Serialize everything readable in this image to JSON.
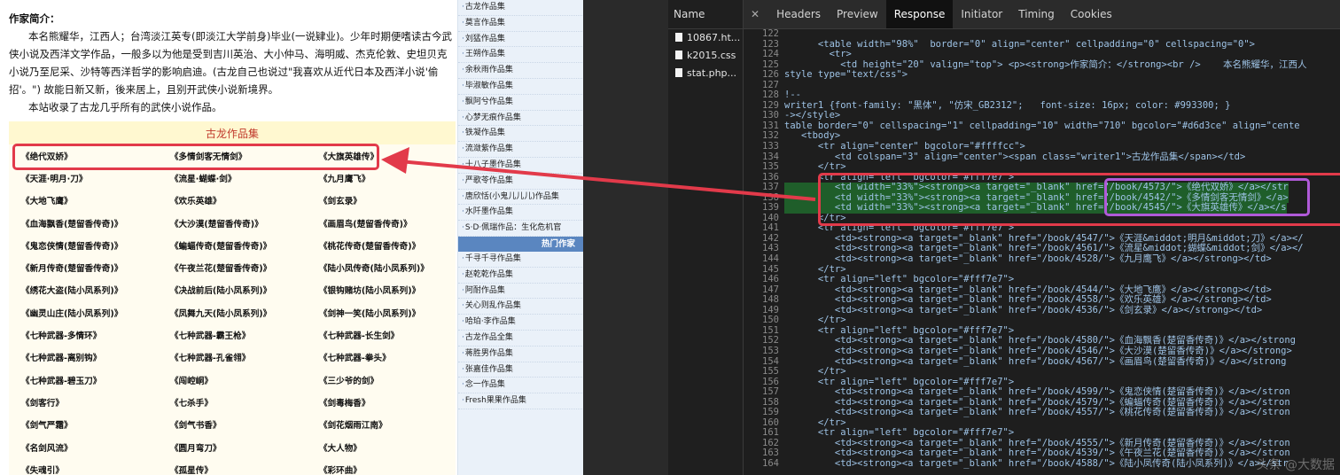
{
  "intro": {
    "heading": "作家简介：",
    "paragraph1": "本名熊耀华，江西人；台湾淡江英专(即淡江大学前身)毕业(一说肄业)。少年时期便嗜读古今武侠小说及西洋文学作品，一般多以为他是受到吉川英治、大小仲马、海明威、杰克伦敦、史坦贝克小说乃至尼采、沙特等西洋哲学的影响启迪。(古龙自己也说过\"我喜欢从近代日本及西洋小说'偷招'。\") 故能日新又新，後来居上，且别开武侠小说新境界。",
    "paragraph2": "本站收录了古龙几乎所有的武侠小说作品。"
  },
  "book_table": {
    "title": "古龙作品集",
    "rows": [
      [
        "《绝代双娇》",
        "《多情剑客无情剑》",
        "《大旗英雄传》"
      ],
      [
        "《天涯·明月·刀》",
        "《流星·蝴蝶·剑》",
        "《九月鹰飞》"
      ],
      [
        "《大地飞鹰》",
        "《欢乐英雄》",
        "《剑玄录》"
      ],
      [
        "《血海飘香(楚留香传奇)》",
        "《大沙漠(楚留香传奇)》",
        "《画眉鸟(楚留香传奇)》"
      ],
      [
        "《鬼恋侠情(楚留香传奇)》",
        "《蝙蝠传奇(楚留香传奇)》",
        "《桃花传奇(楚留香传奇)》"
      ],
      [
        "《新月传奇(楚留香传奇)》",
        "《午夜兰花(楚留香传奇)》",
        "《陆小凤传奇(陆小凤系列)》"
      ],
      [
        "《绣花大盗(陆小凤系列)》",
        "《决战前后(陆小凤系列)》",
        "《银钩赌坊(陆小凤系列)》"
      ],
      [
        "《幽灵山庄(陆小凤系列)》",
        "《凤舞九天(陆小凤系列)》",
        "《剑神一笑(陆小凤系列)》"
      ],
      [
        "《七种武器-多情环》",
        "《七种武器-霸王枪》",
        "《七种武器-长生剑》"
      ],
      [
        "《七种武器-离别钩》",
        "《七种武器-孔雀翎》",
        "《七种武器-拳头》"
      ],
      [
        "《七种武器-碧玉刀》",
        "《闯崆峒》",
        "《三少爷的剑》"
      ],
      [
        "《剑客行》",
        "《七杀手》",
        "《剑毒梅香》"
      ],
      [
        "《剑气严霜》",
        "《剑气书香》",
        "《剑花烟雨江南》"
      ],
      [
        "《名剑风流》",
        "《圆月弯刀》",
        "《大人物》"
      ],
      [
        "《失魂引》",
        "《孤星传》",
        "《彩环曲》"
      ]
    ]
  },
  "sidebar": {
    "items_top": [
      "古龙作品集",
      "莫言作品集",
      "刘猛作品集",
      "王朔作品集",
      "余秋雨作品集",
      "毕淑敏作品集",
      "飘阿兮作品集",
      "心梦无痕作品集",
      "铁凝作品集",
      "流潋紫作品集",
      "十八子墨作品集",
      "严歌苓作品集",
      "唐欣恬(小鬼儿儿儿)作品集",
      "水阡墨作品集",
      "S·D·佩瑞作品：生化危机官"
    ],
    "section_header": "热门作家",
    "items_bottom": [
      "千寻千寻作品集",
      "赵乾乾作品集",
      "阿耐作品集",
      "关心则乱作品集",
      "哈珀·李作品集",
      "古龙作品全集",
      "蒋胜男作品集",
      "张嘉佳作品集",
      "念一作品集",
      "Fresh果果作品集"
    ]
  },
  "devtools": {
    "name_header": "Name",
    "files": [
      "10867.ht...",
      "k2015.css",
      "stat.php..."
    ],
    "tabs": [
      "Headers",
      "Preview",
      "Response",
      "Initiator",
      "Timing",
      "Cookies"
    ],
    "active_tab": "Response",
    "code_lines": [
      {
        "n": "122",
        "t": ""
      },
      {
        "n": "123",
        "t": "      <table width=\"98%\"  border=\"0\" align=\"center\" cellpadding=\"0\" cellspacing=\"0\">"
      },
      {
        "n": "124",
        "t": "        <tr>"
      },
      {
        "n": "125",
        "t": "          <td height=\"20\" valign=\"top\"> <p><strong>作家简介：</strong><br />    本名熊耀华，江西人"
      },
      {
        "n": "126",
        "t": "style type=\"text/css\">"
      },
      {
        "n": "127",
        "t": ""
      },
      {
        "n": "128",
        "t": "!--"
      },
      {
        "n": "129",
        "t": "writer1 {font-family: \"黑体\", \"仿宋_GB2312\";   font-size: 16px; color: #993300; }"
      },
      {
        "n": "130",
        "t": "-></style>"
      },
      {
        "n": "131",
        "t": "table border=\"0\" cellspacing=\"1\" cellpadding=\"10\" width=\"710\" bgcolor=\"#d6d3ce\" align=\"cente"
      },
      {
        "n": "132",
        "t": "   <tbody>"
      },
      {
        "n": "133",
        "t": "      <tr align=\"center\" bgcolor=\"#ffffcc\">"
      },
      {
        "n": "134",
        "t": "         <td colspan=\"3\" align=\"center\"><span class=\"writer1\">古龙作品集</span></td>"
      },
      {
        "n": "135",
        "t": "      </tr>"
      },
      {
        "n": "136",
        "t": "      <tr align=\"left\" bgcolor=\"#fff7e7\">"
      },
      {
        "n": "137",
        "t": "         <td width=\"33%\"><strong><a target=\"_blank\" href=\"/book/4573/\">《绝代双娇》</a></str"
      },
      {
        "n": "138",
        "t": "         <td width=\"33%\"><strong><a target=\"_blank\" href=\"/book/4542/\">《多情剑客无情剑》</a>"
      },
      {
        "n": "139",
        "t": "         <td width=\"33%\"><strong><a target=\"_blank\" href=\"/book/4545/\">《大旗英雄传》</a></s"
      },
      {
        "n": "140",
        "t": "      </tr>"
      },
      {
        "n": "141",
        "t": "      <tr align=\"left\" bgcolor=\"#fff7e7\">"
      },
      {
        "n": "142",
        "t": "         <td><strong><a target=\"_blank\" href=\"/book/4547/\">《天涯&middot;明月&middot;刀》</a></"
      },
      {
        "n": "143",
        "t": "         <td><strong><a target=\"_blank\" href=\"/book/4561/\">《流星&middot;蝴蝶&middot;剑》</a></"
      },
      {
        "n": "144",
        "t": "         <td><strong><a target=\"_blank\" href=\"/book/4528/\">《九月鹰飞》</a></strong></td>"
      },
      {
        "n": "145",
        "t": "      </tr>"
      },
      {
        "n": "146",
        "t": "      <tr align=\"left\" bgcolor=\"#fff7e7\">"
      },
      {
        "n": "147",
        "t": "         <td><strong><a target=\"_blank\" href=\"/book/4544/\">《大地飞鹰》</a></strong></td>"
      },
      {
        "n": "148",
        "t": "         <td><strong><a target=\"_blank\" href=\"/book/4558/\">《欢乐英雄》</a></strong></td>"
      },
      {
        "n": "149",
        "t": "         <td><strong><a target=\"_blank\" href=\"/book/4536/\">《剑玄录》</a></strong></td>"
      },
      {
        "n": "150",
        "t": "      </tr>"
      },
      {
        "n": "151",
        "t": "      <tr align=\"left\" bgcolor=\"#fff7e7\">"
      },
      {
        "n": "152",
        "t": "         <td><strong><a target=\"_blank\" href=\"/book/4580/\">《血海飘香(楚留香传奇)》</a></strong"
      },
      {
        "n": "153",
        "t": "         <td><strong><a target=\"_blank\" href=\"/book/4546/\">《大沙漠(楚留香传奇)》</a></strong>"
      },
      {
        "n": "154",
        "t": "         <td><strong><a target=\"_blank\" href=\"/book/4567/\">《画眉鸟(楚留香传奇)》</a></strong"
      },
      {
        "n": "155",
        "t": "      </tr>"
      },
      {
        "n": "156",
        "t": "      <tr align=\"left\" bgcolor=\"#fff7e7\">"
      },
      {
        "n": "157",
        "t": "         <td><strong><a target=\"_blank\" href=\"/book/4599/\">《鬼恋侠情(楚留香传奇)》</a></stron"
      },
      {
        "n": "158",
        "t": "         <td><strong><a target=\"_blank\" href=\"/book/4579/\">《蝙蝠传奇(楚留香传奇)》</a></stron"
      },
      {
        "n": "159",
        "t": "         <td><strong><a target=\"_blank\" href=\"/book/4557/\">《桃花传奇(楚留香传奇)》</a></stron"
      },
      {
        "n": "160",
        "t": "      </tr>"
      },
      {
        "n": "161",
        "t": "      <tr align=\"left\" bgcolor=\"#fff7e7\">"
      },
      {
        "n": "162",
        "t": "         <td><strong><a target=\"_blank\" href=\"/book/4555/\">《新月传奇(楚留香传奇)》</a></stron"
      },
      {
        "n": "163",
        "t": "         <td><strong><a target=\"_blank\" href=\"/book/4539/\">《午夜兰花(楚留香传奇)》</a></stron"
      },
      {
        "n": "164",
        "t": "         <td><strong><a target=\"_blank\" href=\"/book/4588/\">《陆小凤传奇(陆小凤系列)》</a></str"
      }
    ],
    "highlight_lines": [
      "137",
      "138",
      "139"
    ]
  },
  "watermark": "头条 @大数据"
}
